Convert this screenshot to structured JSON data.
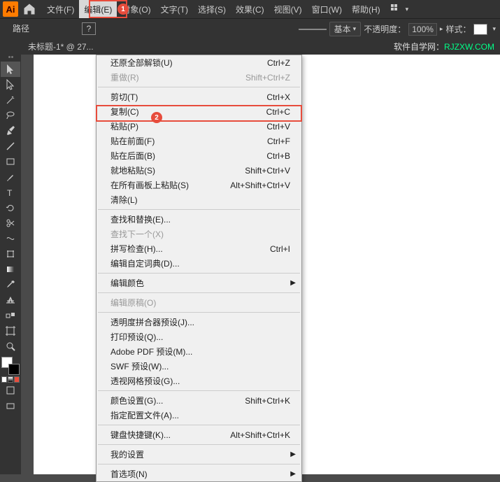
{
  "app": {
    "logo": "Ai"
  },
  "menubar": {
    "items": [
      {
        "label": "文件(F)"
      },
      {
        "label": "编辑(E)",
        "active": true
      },
      {
        "label": "对象(O)"
      },
      {
        "label": "文字(T)"
      },
      {
        "label": "选择(S)"
      },
      {
        "label": "效果(C)"
      },
      {
        "label": "视图(V)"
      },
      {
        "label": "窗口(W)"
      },
      {
        "label": "帮助(H)"
      }
    ]
  },
  "badges": {
    "b1": "1",
    "b2": "2"
  },
  "toolbar2": {
    "path": "路径",
    "question": "?",
    "basic": "基本",
    "opacity_label": "不透明度：",
    "opacity_value": "100%",
    "style_label": "样式："
  },
  "doc": {
    "tab": "未标题-1* @ 27..."
  },
  "watermark": {
    "prefix": "软件自学网：",
    "url": "RJZXW.COM"
  },
  "edit_menu": {
    "items": [
      {
        "label": "还原全部解锁(U)",
        "shortcut": "Ctrl+Z"
      },
      {
        "label": "重做(R)",
        "shortcut": "Shift+Ctrl+Z",
        "disabled": true
      },
      {
        "sep": true
      },
      {
        "label": "剪切(T)",
        "shortcut": "Ctrl+X"
      },
      {
        "label": "复制(C)",
        "shortcut": "Ctrl+C"
      },
      {
        "label": "粘贴(P)",
        "shortcut": "Ctrl+V"
      },
      {
        "label": "贴在前面(F)",
        "shortcut": "Ctrl+F"
      },
      {
        "label": "贴在后面(B)",
        "shortcut": "Ctrl+B"
      },
      {
        "label": "就地粘贴(S)",
        "shortcut": "Shift+Ctrl+V"
      },
      {
        "label": "在所有画板上粘贴(S)",
        "shortcut": "Alt+Shift+Ctrl+V"
      },
      {
        "label": "清除(L)"
      },
      {
        "sep": true
      },
      {
        "label": "查找和替换(E)..."
      },
      {
        "label": "查找下一个(X)",
        "disabled": true
      },
      {
        "label": "拼写检查(H)...",
        "shortcut": "Ctrl+I"
      },
      {
        "label": "编辑自定词典(D)..."
      },
      {
        "sep": true
      },
      {
        "label": "编辑颜色",
        "submenu": true
      },
      {
        "sep": true
      },
      {
        "label": "编辑原稿(O)",
        "disabled": true
      },
      {
        "sep": true
      },
      {
        "label": "透明度拼合器预设(J)..."
      },
      {
        "label": "打印预设(Q)..."
      },
      {
        "label": "Adobe PDF 预设(M)..."
      },
      {
        "label": "SWF 预设(W)..."
      },
      {
        "label": "透视网格预设(G)..."
      },
      {
        "sep": true
      },
      {
        "label": "颜色设置(G)...",
        "shortcut": "Shift+Ctrl+K"
      },
      {
        "label": "指定配置文件(A)..."
      },
      {
        "sep": true
      },
      {
        "label": "键盘快捷键(K)...",
        "shortcut": "Alt+Shift+Ctrl+K"
      },
      {
        "sep": true
      },
      {
        "label": "我的设置",
        "submenu": true
      },
      {
        "sep": true
      },
      {
        "label": "首选项(N)",
        "submenu": true
      }
    ]
  }
}
